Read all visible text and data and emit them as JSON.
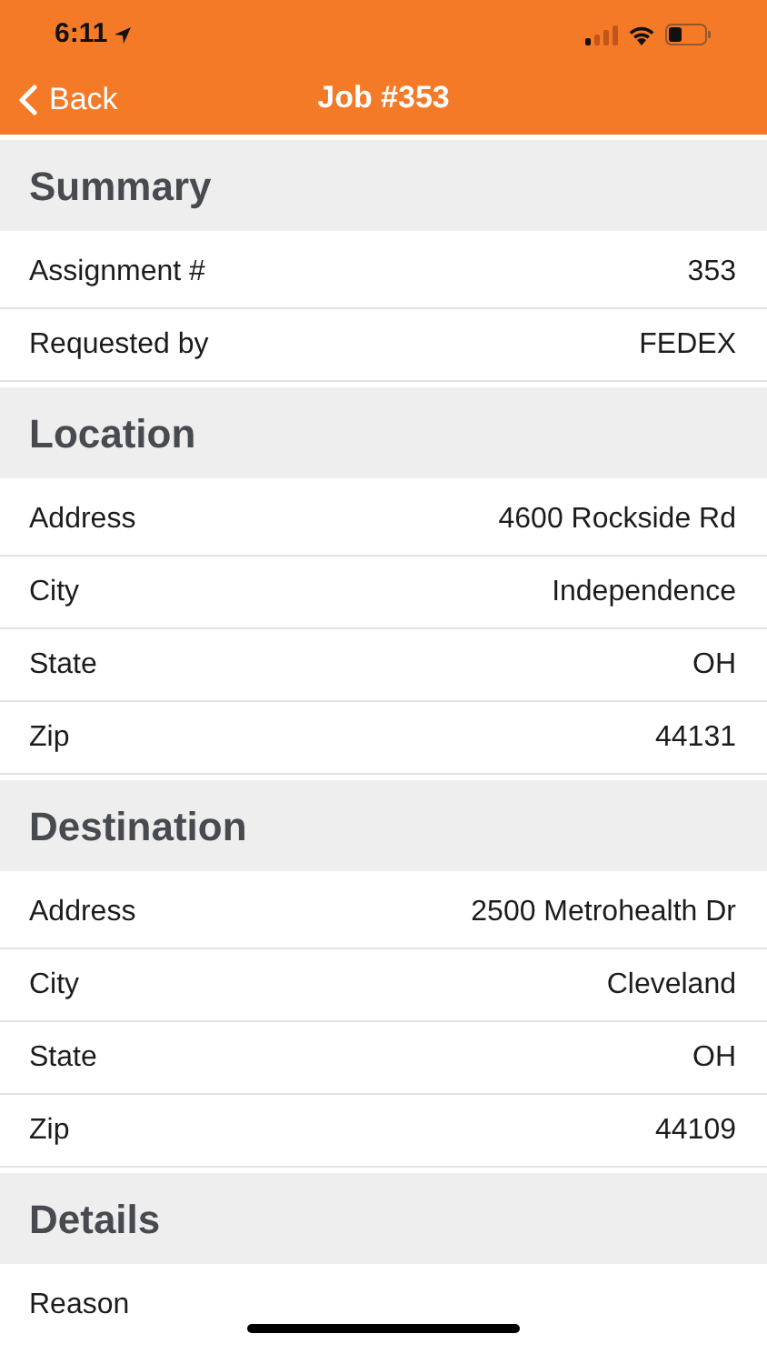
{
  "status_bar": {
    "time": "6:11"
  },
  "nav": {
    "back": "Back",
    "title": "Job #353"
  },
  "sections": [
    {
      "title": "Summary",
      "rows": [
        {
          "label": "Assignment #",
          "value": "353"
        },
        {
          "label": "Requested by",
          "value": "FEDEX"
        }
      ]
    },
    {
      "title": "Location",
      "rows": [
        {
          "label": "Address",
          "value": "4600 Rockside Rd"
        },
        {
          "label": "City",
          "value": "Independence"
        },
        {
          "label": "State",
          "value": "OH"
        },
        {
          "label": "Zip",
          "value": "44131"
        }
      ]
    },
    {
      "title": "Destination",
      "rows": [
        {
          "label": "Address",
          "value": "2500 Metrohealth Dr"
        },
        {
          "label": "City",
          "value": "Cleveland"
        },
        {
          "label": "State",
          "value": "OH"
        },
        {
          "label": "Zip",
          "value": "44109"
        }
      ]
    },
    {
      "title": "Details",
      "rows": [
        {
          "label": "Reason"
        }
      ]
    }
  ]
}
